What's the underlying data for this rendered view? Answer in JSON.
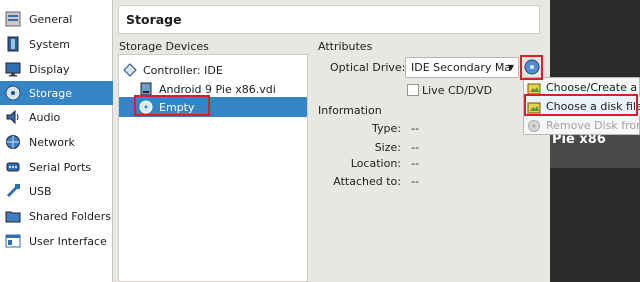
{
  "sidebar": {
    "items": [
      {
        "label": "General",
        "icon": "general-icon"
      },
      {
        "label": "System",
        "icon": "system-chip-icon"
      },
      {
        "label": "Display",
        "icon": "monitor-icon"
      },
      {
        "label": "Storage",
        "icon": "storage-disc-icon",
        "selected": true
      },
      {
        "label": "Audio",
        "icon": "speaker-icon"
      },
      {
        "label": "Network",
        "icon": "network-icon"
      },
      {
        "label": "Serial Ports",
        "icon": "serial-port-icon"
      },
      {
        "label": "USB",
        "icon": "usb-icon"
      },
      {
        "label": "Shared Folders",
        "icon": "folder-icon"
      },
      {
        "label": "User Interface",
        "icon": "user-interface-icon"
      }
    ]
  },
  "header": {
    "title": "Storage"
  },
  "storage_devices": {
    "label": "Storage Devices",
    "controller": "Controller: IDE",
    "disk": "Android 9 Pie x86.vdi",
    "optical": "Empty"
  },
  "attributes": {
    "label": "Attributes",
    "optical_drive_label": "Optical Drive:",
    "optical_drive_value": "IDE Secondary Ma",
    "live_cd_label": "Live CD/DVD",
    "live_cd_checked": false
  },
  "information": {
    "label": "Information",
    "rows": [
      {
        "key": "Type:",
        "value": "--"
      },
      {
        "key": "Size:",
        "value": "--"
      },
      {
        "key": "Location:",
        "value": "--"
      },
      {
        "key": "Attached to:",
        "value": "--"
      }
    ]
  },
  "menu": {
    "items": [
      {
        "label": "Choose/Create a V",
        "enabled": true
      },
      {
        "label": "Choose a disk file...",
        "enabled": true
      },
      {
        "label": "Remove Disk from",
        "enabled": false
      }
    ]
  },
  "preview": {
    "text": "Pie x86"
  },
  "colors": {
    "selection": "#3584c6",
    "annotation": "#d9202a"
  }
}
